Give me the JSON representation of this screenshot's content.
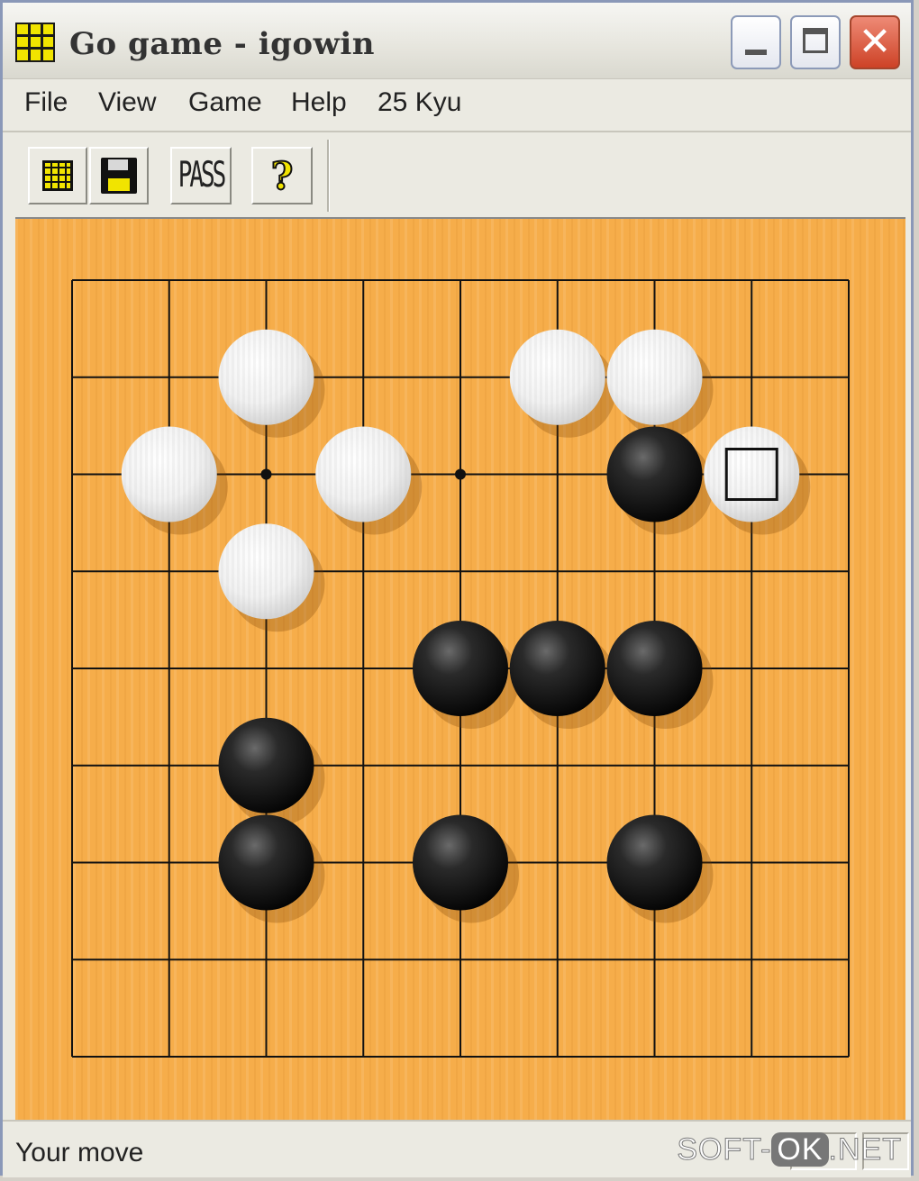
{
  "window": {
    "title": "Go game - igowin"
  },
  "menu": {
    "items": [
      "File",
      "View",
      "Game",
      "Help",
      "25 Kyu"
    ]
  },
  "toolbar": {
    "pass_label": "PASS",
    "help_label": "?"
  },
  "board": {
    "size": 9,
    "colors": {
      "wood": "#f6ad4a",
      "line": "#111111",
      "black_stone": "#111111",
      "white_stone": "#f4f4f4"
    },
    "hoshi": [
      [
        2,
        2
      ],
      [
        4,
        2
      ],
      [
        2,
        6
      ]
    ],
    "stones": [
      {
        "color": "white",
        "col": 2,
        "row": 1
      },
      {
        "color": "white",
        "col": 5,
        "row": 1
      },
      {
        "color": "white",
        "col": 6,
        "row": 1
      },
      {
        "color": "white",
        "col": 1,
        "row": 2
      },
      {
        "color": "white",
        "col": 3,
        "row": 2
      },
      {
        "color": "black",
        "col": 6,
        "row": 2
      },
      {
        "color": "white",
        "col": 7,
        "row": 2,
        "last_move": true
      },
      {
        "color": "white",
        "col": 2,
        "row": 3
      },
      {
        "color": "black",
        "col": 4,
        "row": 4
      },
      {
        "color": "black",
        "col": 5,
        "row": 4
      },
      {
        "color": "black",
        "col": 6,
        "row": 4
      },
      {
        "color": "black",
        "col": 2,
        "row": 5
      },
      {
        "color": "black",
        "col": 2,
        "row": 6
      },
      {
        "color": "black",
        "col": 4,
        "row": 6
      },
      {
        "color": "black",
        "col": 6,
        "row": 6
      }
    ]
  },
  "status": {
    "text": "Your move"
  },
  "watermark": {
    "left": "SOFT-",
    "mid": "OK",
    "right": ".NET"
  }
}
